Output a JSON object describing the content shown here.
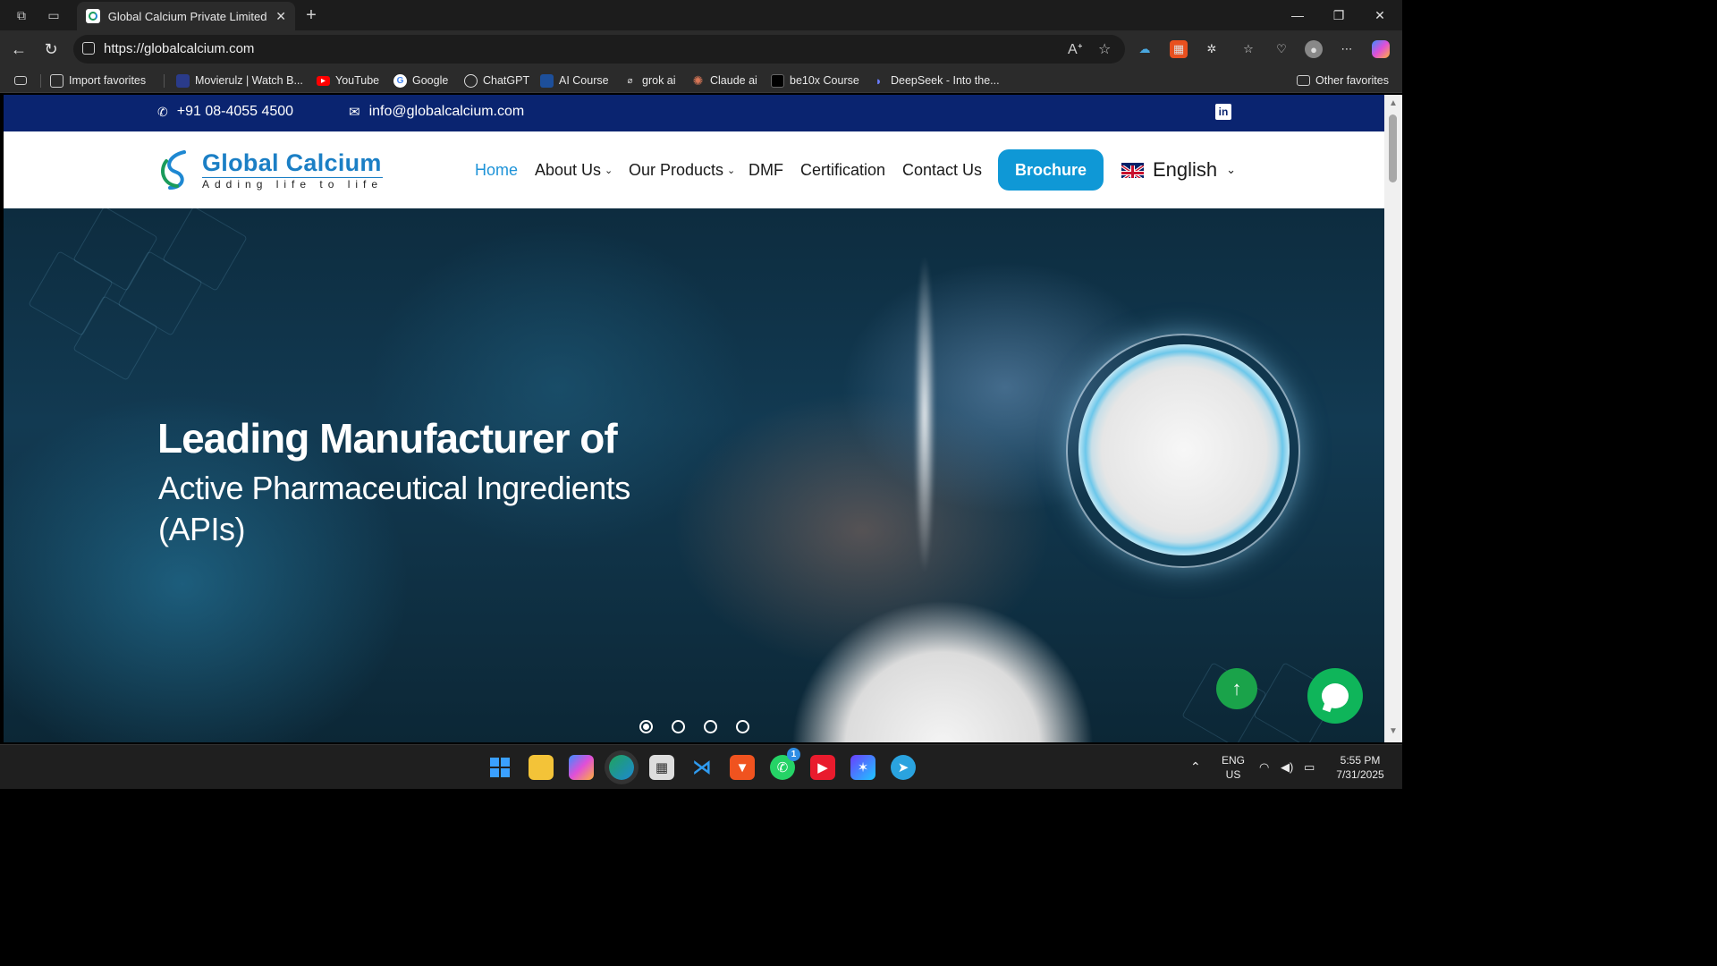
{
  "browser": {
    "tab_title": "Global Calcium Private Limited | G",
    "url": "https://globalcalcium.com",
    "favorites": [
      "Import favorites",
      "Movierulz | Watch B...",
      "YouTube",
      "Google",
      "ChatGPT",
      "AI Course",
      "grok ai",
      "Claude ai",
      "be10x Course",
      "DeepSeek - Into the..."
    ],
    "other_favorites": "Other favorites"
  },
  "site": {
    "phone": "+91 08-4055 4500",
    "email": "info@globalcalcium.com",
    "logo_name": "Global Calcium",
    "logo_tagline": "Adding life to life",
    "nav": {
      "home": "Home",
      "about": "About Us",
      "products": "Our Products",
      "dmf": "DMF",
      "certification": "Certification",
      "contact": "Contact Us",
      "brochure": "Brochure",
      "language": "English"
    },
    "hero": {
      "heading": "Leading Manufacturer of",
      "subheading": "Active Pharmaceutical Ingredients (APIs)",
      "slides": 4,
      "active_slide": 1
    }
  },
  "taskbar": {
    "whatsapp_badge": "1",
    "lang_top": "ENG",
    "lang_bottom": "US",
    "time": "5:55 PM",
    "date": "7/31/2025"
  },
  "colors": {
    "topbar": "#0a2470",
    "accent_blue": "#0f98d6",
    "active_nav": "#1e93d8",
    "green": "#1aa34a"
  }
}
